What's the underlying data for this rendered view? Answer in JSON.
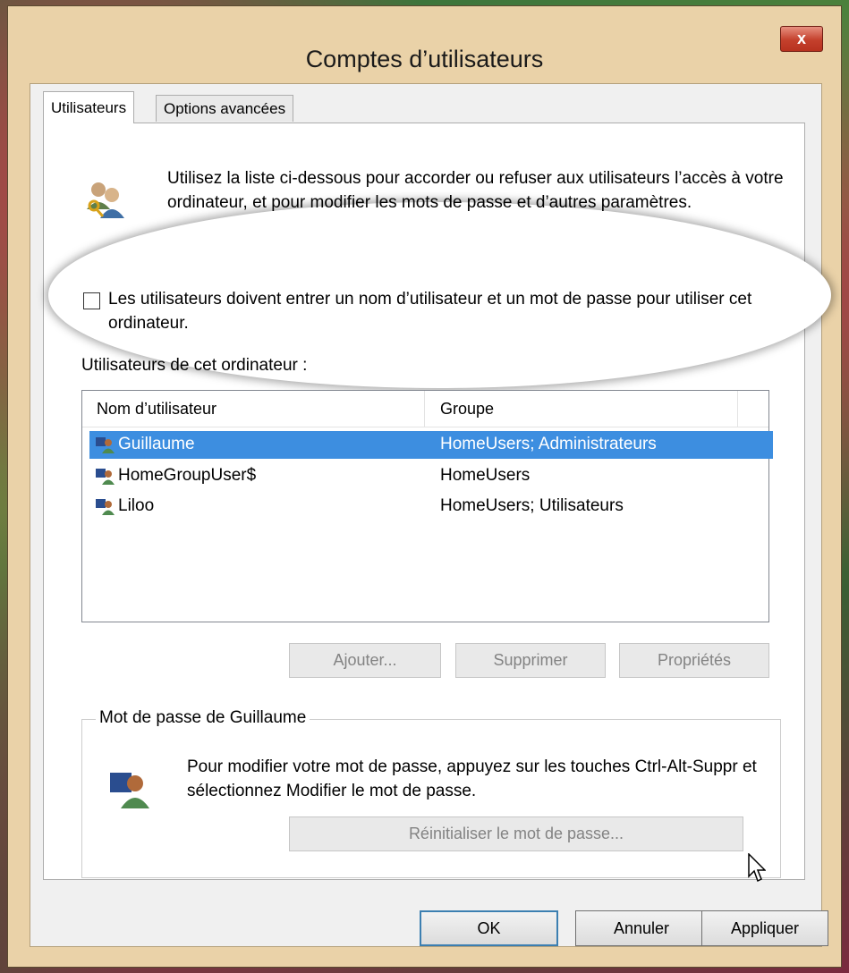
{
  "window": {
    "title": "Comptes d’utilisateurs",
    "close_glyph": "x"
  },
  "tabs": [
    {
      "label": "Utilisateurs",
      "active": true
    },
    {
      "label": "Options avancées",
      "active": false
    }
  ],
  "intro": "Utilisez la liste ci-dessous pour accorder ou refuser aux utilisateurs l’accès à votre ordinateur, et pour modifier les mots de passe et d’autres paramètres.",
  "require_login": {
    "checked": false,
    "label": "Les utilisateurs doivent entrer un nom d’utilisateur et un mot de passe pour utiliser cet ordinateur."
  },
  "users_section_label": "Utilisateurs de cet ordinateur :",
  "users_table": {
    "columns": [
      "Nom d’utilisateur",
      "Groupe"
    ],
    "rows": [
      {
        "name": "Guillaume",
        "group": "HomeUsers; Administrateurs",
        "selected": true
      },
      {
        "name": "HomeGroupUser$",
        "group": "HomeUsers",
        "selected": false
      },
      {
        "name": "Liloo",
        "group": "HomeUsers; Utilisateurs",
        "selected": false
      }
    ]
  },
  "user_buttons": {
    "add": "Ajouter...",
    "remove": "Supprimer",
    "properties": "Propriétés"
  },
  "password_group": {
    "title": "Mot de passe de Guillaume",
    "text": "Pour modifier votre mot de passe, appuyez sur les touches Ctrl-Alt-Suppr et sélectionnez Modifier le mot de passe.",
    "reset_button": "Réinitialiser le mot de passe..."
  },
  "footer_buttons": {
    "ok": "OK",
    "cancel": "Annuler",
    "apply": "Appliquer"
  },
  "colors": {
    "selection": "#3d8ee0",
    "close_button": "#c4402c",
    "window_frame": "#ead2a8"
  },
  "icons": [
    "close-icon",
    "users-icon",
    "user-icon",
    "password-user-icon",
    "mouse-cursor-icon"
  ]
}
